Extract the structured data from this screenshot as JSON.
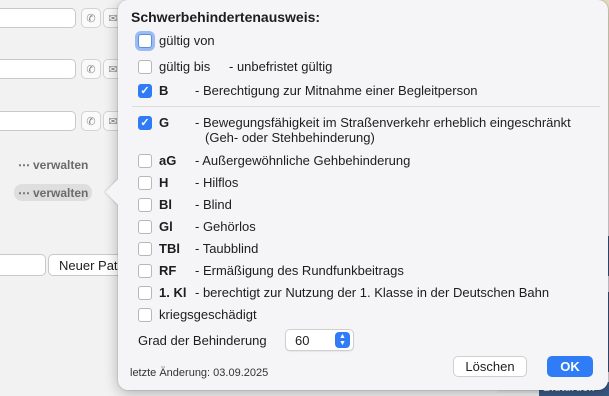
{
  "background": {
    "manage_label_1": "verwalten",
    "manage_label_2": "verwalten",
    "new_patient_button": "Neuer Pat",
    "right_panel_label": "Blutdruck"
  },
  "popover": {
    "title": "Schwerbehindertenausweis:",
    "valid_from": {
      "label": "gültig von",
      "checked": false
    },
    "valid_until": {
      "label": "gültig bis",
      "extra": "- unbefristet gültig",
      "checked": false
    },
    "items_top": [
      {
        "code": "B",
        "desc": "- Berechtigung zur Mitnahme einer Begleitperson",
        "checked": true
      }
    ],
    "items": [
      {
        "code": "G",
        "desc": "- Bewegungsfähigkeit im Straßenverkehr erheblich eingeschränkt",
        "desc2": "(Geh- oder Stehbehinderung)",
        "checked": true
      },
      {
        "code": "aG",
        "desc": "- Außergewöhnliche Gehbehinderung",
        "checked": false
      },
      {
        "code": "H",
        "desc": "- Hilflos",
        "checked": false
      },
      {
        "code": "Bl",
        "desc": "- Blind",
        "checked": false
      },
      {
        "code": "Gl",
        "desc": "- Gehörlos",
        "checked": false
      },
      {
        "code": "TBl",
        "desc": "- Taubblind",
        "checked": false
      },
      {
        "code": "RF",
        "desc": "- Ermäßigung des Rundfunkbeitrags",
        "checked": false
      },
      {
        "code": "1. Kl",
        "desc": "- berechtigt zur Nutzung der 1. Klasse in der Deutschen Bahn",
        "checked": false
      }
    ],
    "war_damaged": {
      "label": "kriegsgeschädigt",
      "checked": false
    },
    "degree_label": "Grad der Behinderung",
    "degree_value": "60",
    "last_change": "letzte Änderung: 03.09.2025",
    "delete_button": "Löschen",
    "ok_button": "OK",
    "accent_color": "#2f7cf6"
  }
}
